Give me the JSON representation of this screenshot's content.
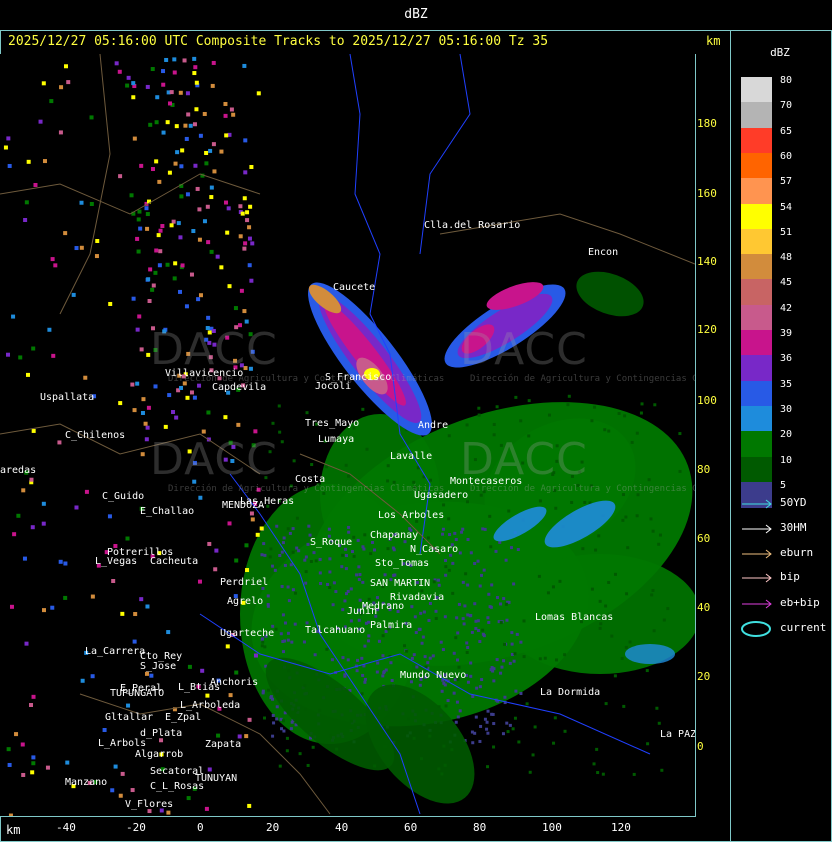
{
  "title": "dBZ",
  "header": "2025/12/27 05:16:00 UTC Composite Tracks to 2025/12/27 05:16:00 Tz 35",
  "km_label": "km",
  "y_ticks": [
    "180",
    "160",
    "140",
    "120",
    "100",
    "80",
    "60",
    "40",
    "20",
    "0"
  ],
  "x_ticks": [
    "-40",
    "-20",
    "0",
    "20",
    "40",
    "60",
    "80",
    "100",
    "120"
  ],
  "legend": {
    "title": "dBZ",
    "levels": [
      {
        "label": "80",
        "color": "#d8d8d8"
      },
      {
        "label": "70",
        "color": "#b4b4b4"
      },
      {
        "label": "65",
        "color": "#ff3c28"
      },
      {
        "label": "60",
        "color": "#ff6400"
      },
      {
        "label": "57",
        "color": "#ff9450"
      },
      {
        "label": "54",
        "color": "#ffff00"
      },
      {
        "label": "51",
        "color": "#ffc832"
      },
      {
        "label": "48",
        "color": "#d28c3c"
      },
      {
        "label": "45",
        "color": "#c86464"
      },
      {
        "label": "42",
        "color": "#c85a8c"
      },
      {
        "label": "39",
        "color": "#c8148c"
      },
      {
        "label": "36",
        "color": "#7828c8"
      },
      {
        "label": "35",
        "color": "#285ae6"
      },
      {
        "label": "30",
        "color": "#1e8cdc"
      },
      {
        "label": "20",
        "color": "#007800"
      },
      {
        "label": "10",
        "color": "#005a00"
      },
      {
        "label": "5",
        "color": "#3c3c8c"
      }
    ],
    "tracks": [
      {
        "label": "50YD",
        "color": "#40e0e0"
      },
      {
        "label": "30HM",
        "color": "#ffffff"
      },
      {
        "label": "eburn",
        "color": "#f0c080"
      },
      {
        "label": "bip",
        "color": "#ffc8c8"
      },
      {
        "label": "eb+bip",
        "color": "#e040e0"
      },
      {
        "label": "current",
        "color": "#40e0e0"
      }
    ]
  },
  "places": [
    {
      "name": "Clla.del Rosario"
    },
    {
      "name": "Encon"
    },
    {
      "name": "Caucete"
    },
    {
      "name": "Villavicencio"
    },
    {
      "name": "Uspallata"
    },
    {
      "name": "C_Chilenos"
    },
    {
      "name": "aredas"
    },
    {
      "name": "C_Guido"
    },
    {
      "name": "Capdevila"
    },
    {
      "name": "Jocoli"
    },
    {
      "name": "S_Francisco"
    },
    {
      "name": "Tres_Mayo"
    },
    {
      "name": "Lumaya"
    },
    {
      "name": "Andre"
    },
    {
      "name": "Lavalle"
    },
    {
      "name": "Costa"
    },
    {
      "name": "E_Challao"
    },
    {
      "name": "MENDOZA"
    },
    {
      "name": "Las_Heras"
    },
    {
      "name": "Potrerillos"
    },
    {
      "name": "L_Vegas"
    },
    {
      "name": "Cacheuta"
    },
    {
      "name": "Perdriel"
    },
    {
      "name": "Agrelo"
    },
    {
      "name": "Ugarteche"
    },
    {
      "name": "La_Carrera"
    },
    {
      "name": "Cto_Rey"
    },
    {
      "name": "S_Jose"
    },
    {
      "name": "E_Peral"
    },
    {
      "name": "TUPUNGATO"
    },
    {
      "name": "Anchoris"
    },
    {
      "name": "L_Btias"
    },
    {
      "name": "L_Arboleda"
    },
    {
      "name": "Gltallar"
    },
    {
      "name": "E_Zpal"
    },
    {
      "name": "L_Arbols"
    },
    {
      "name": "d_Plata"
    },
    {
      "name": "Zapata"
    },
    {
      "name": "Algarrob"
    },
    {
      "name": "Manzano"
    },
    {
      "name": "Secatoral"
    },
    {
      "name": "TUNUYAN"
    },
    {
      "name": "C_L_Rosas"
    },
    {
      "name": "V_Flores"
    },
    {
      "name": "SAN MARTIN"
    },
    {
      "name": "Rivadavia"
    },
    {
      "name": "N_Casaro"
    },
    {
      "name": "Chapanay"
    },
    {
      "name": "Los Arboles"
    },
    {
      "name": "Lomas Blancas"
    },
    {
      "name": "La Dormida"
    },
    {
      "name": "La PAZ"
    },
    {
      "name": "S_Roque"
    },
    {
      "name": "Montecaseros"
    },
    {
      "name": "Medrano"
    },
    {
      "name": "Ugasadero"
    },
    {
      "name": "Sto_Tomas"
    },
    {
      "name": "Talcahuano"
    },
    {
      "name": "Palmira"
    },
    {
      "name": "Junin"
    },
    {
      "name": "Mundo Nuevo"
    }
  ],
  "watermark": {
    "text": "DACC",
    "subtitle": "Dirección de Agricultura y Contingencias Climáticas"
  }
}
